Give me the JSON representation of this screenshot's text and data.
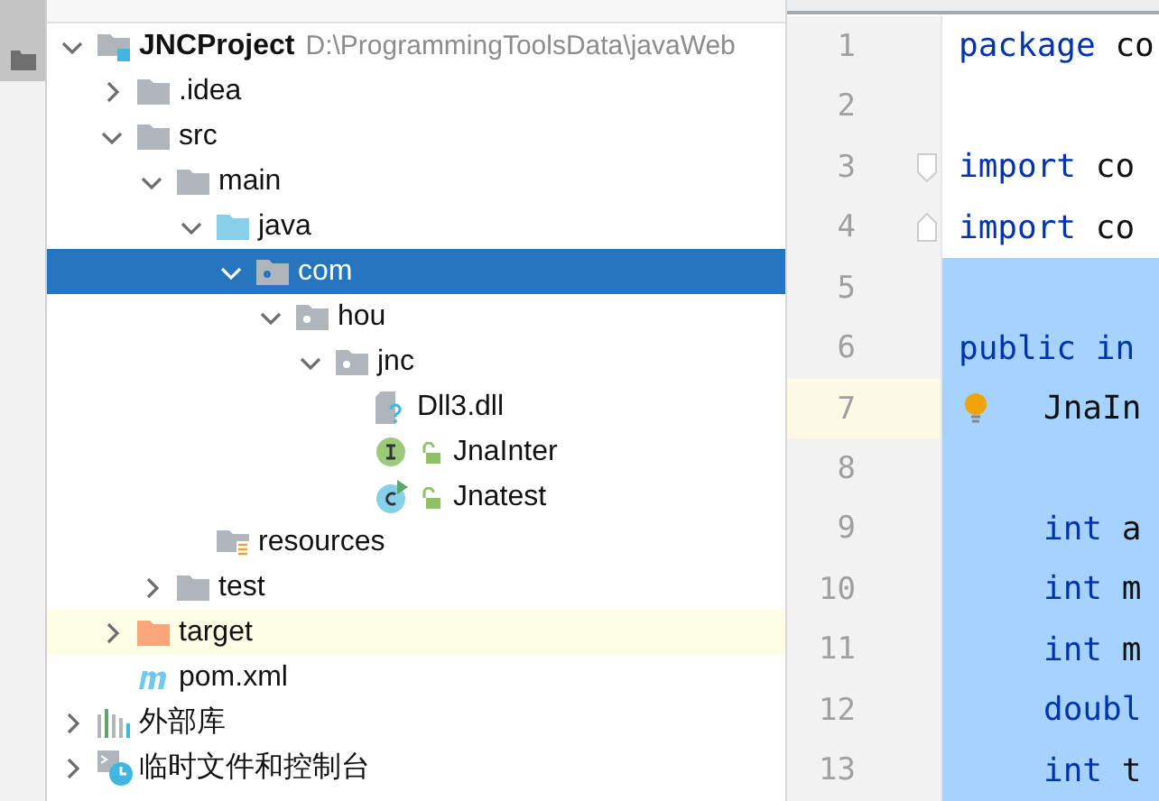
{
  "tool_strip": {
    "selected": true
  },
  "tree": [
    {
      "label": "JNCProject",
      "bold": true,
      "hint": "D:\\ProgrammingToolsData\\javaWeb",
      "kind": "module",
      "expanded": true,
      "selected": false,
      "highlighted": false,
      "children": [
        {
          "label": ".idea",
          "kind": "folder",
          "expanded": false,
          "selected": false,
          "highlighted": false
        },
        {
          "label": "src",
          "kind": "folder",
          "expanded": true,
          "selected": false,
          "highlighted": false,
          "children": [
            {
              "label": "main",
              "kind": "folder",
              "expanded": true,
              "selected": false,
              "highlighted": false,
              "children": [
                {
                  "label": "java",
                  "kind": "sourceroot",
                  "expanded": true,
                  "selected": false,
                  "highlighted": false,
                  "children": [
                    {
                      "label": "com",
                      "kind": "package",
                      "expanded": true,
                      "selected": true,
                      "highlighted": false,
                      "children": [
                        {
                          "label": "hou",
                          "kind": "package",
                          "expanded": true,
                          "selected": false,
                          "highlighted": false,
                          "children": [
                            {
                              "label": "jnc",
                              "kind": "package",
                              "expanded": true,
                              "selected": false,
                              "highlighted": false,
                              "children": [
                                {
                                  "label": "Dll3.dll",
                                  "kind": "unknown",
                                  "selected": false,
                                  "highlighted": false
                                },
                                {
                                  "label": "JnaInter",
                                  "kind": "interface",
                                  "locked": true,
                                  "selected": false,
                                  "highlighted": false
                                },
                                {
                                  "label": "Jnatest",
                                  "kind": "runnable",
                                  "locked": true,
                                  "selected": false,
                                  "highlighted": false
                                }
                              ]
                            }
                          ]
                        }
                      ]
                    }
                  ]
                },
                {
                  "label": "resources",
                  "kind": "resources",
                  "selected": false,
                  "highlighted": false
                }
              ]
            },
            {
              "label": "test",
              "kind": "folder",
              "expanded": false,
              "selected": false,
              "highlighted": false
            }
          ]
        },
        {
          "label": "target",
          "kind": "excluded",
          "expanded": false,
          "selected": false,
          "highlighted": true
        },
        {
          "label": "pom.xml",
          "kind": "maven",
          "selected": false,
          "highlighted": false
        }
      ]
    },
    {
      "label": "外部库",
      "kind": "library",
      "expanded": false,
      "selected": false,
      "highlighted": false
    },
    {
      "label": "临时文件和控制台",
      "kind": "scratches",
      "expanded": false,
      "selected": false,
      "highlighted": false
    }
  ],
  "editor": {
    "lines": [
      {
        "number": "1",
        "kind": "plain",
        "keyword": "package",
        "rest": "co",
        "selected": false,
        "current": false
      },
      {
        "number": "2",
        "kind": "plain",
        "selected": false,
        "current": false
      },
      {
        "number": "3",
        "kind": "foldstart",
        "keyword": "import",
        "rest": "co",
        "selected": false,
        "current": false
      },
      {
        "number": "4",
        "kind": "foldend",
        "keyword": "import",
        "rest": "co",
        "selected": false,
        "current": false
      },
      {
        "number": "5",
        "kind": "plain",
        "selected": true,
        "current": false
      },
      {
        "number": "6",
        "kind": "plain",
        "keyword": "public",
        "rest": "in",
        "rest_keyword": true,
        "selected": true,
        "current": false
      },
      {
        "number": "7",
        "kind": "plain",
        "rest": "JnaIn",
        "indented": true,
        "bulb": true,
        "selected": true,
        "current": true
      },
      {
        "number": "8",
        "kind": "plain",
        "selected": true,
        "current": false
      },
      {
        "number": "9",
        "kind": "plain",
        "keyword": "int",
        "rest": "a",
        "indented": true,
        "selected": true,
        "current": false
      },
      {
        "number": "10",
        "kind": "plain",
        "keyword": "int",
        "rest": "m",
        "indented": true,
        "selected": true,
        "current": false
      },
      {
        "number": "11",
        "kind": "plain",
        "keyword": "int",
        "rest": "m",
        "indented": true,
        "selected": true,
        "current": false
      },
      {
        "number": "12",
        "kind": "plain",
        "rest": "doubl",
        "rest_keyword": true,
        "indented": true,
        "selected": true,
        "current": false
      },
      {
        "number": "13",
        "kind": "plain",
        "keyword": "int",
        "rest": "t",
        "indented": true,
        "selected": true,
        "current": false
      }
    ]
  }
}
